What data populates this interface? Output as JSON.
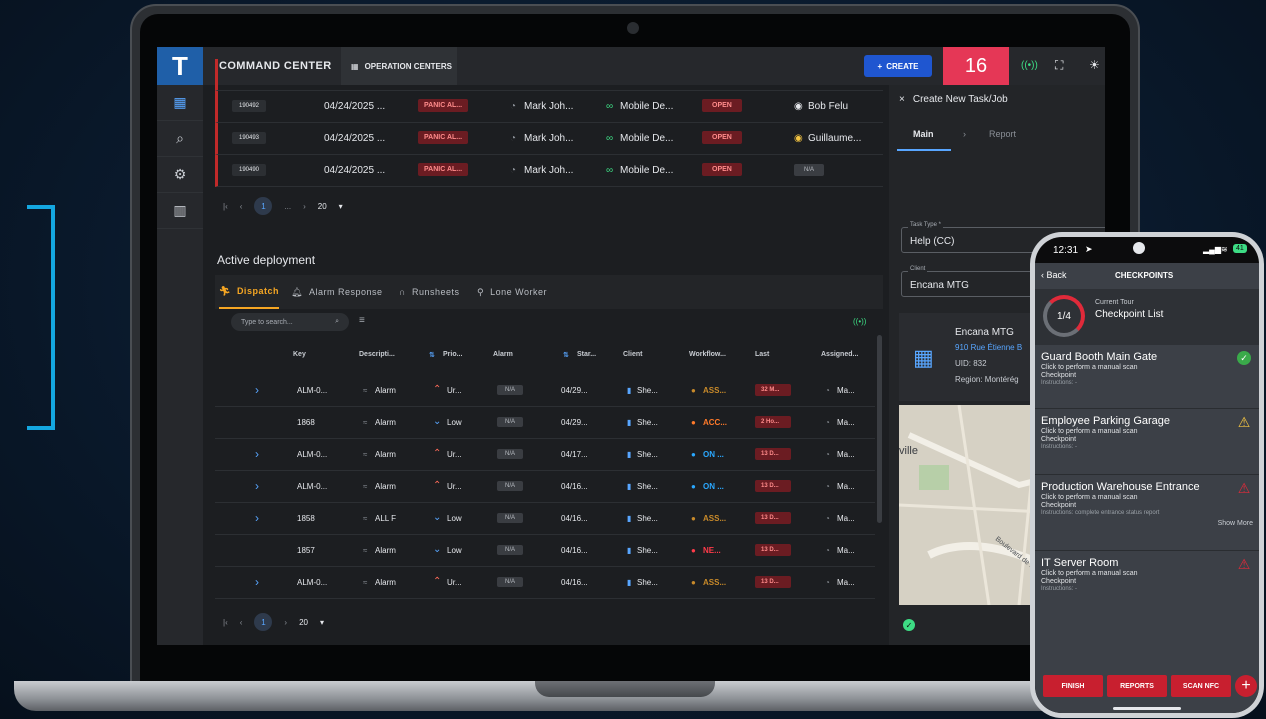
{
  "header": {
    "logo": "T",
    "app_title": "COMMAND CENTER",
    "operation_centers": "OPERATION CENTERS",
    "create": "CREATE",
    "notifications_count": "16"
  },
  "panic_rows": [
    {
      "id": "190492",
      "date": "04/24/2025 ...",
      "alarm": "PANIC AL...",
      "officer": "Mark Joh...",
      "device": "Mobile De...",
      "status": "OPEN",
      "assignee": "Bob Felu"
    },
    {
      "id": "190493",
      "date": "04/24/2025 ...",
      "alarm": "PANIC AL...",
      "officer": "Mark Joh...",
      "device": "Mobile De...",
      "status": "OPEN",
      "assignee": "Guillaume..."
    },
    {
      "id": "190490",
      "date": "04/24/2025 ...",
      "alarm": "PANIC AL...",
      "officer": "Mark Joh...",
      "device": "Mobile De...",
      "status": "OPEN",
      "assignee": "N/A"
    }
  ],
  "pager_top": {
    "page": "1",
    "ellipsis": "...",
    "page_size": "20"
  },
  "active_deployment": {
    "title": "Active deployment",
    "tabs": [
      "Dispatch",
      "Alarm Response",
      "Runsheets",
      "Lone Worker"
    ],
    "search_placeholder": "Type to search...",
    "columns": [
      "Key",
      "Descripti...",
      "Prio...",
      "Alarm",
      "Star...",
      "Client",
      "Workflow...",
      "Last",
      "Assigned..."
    ],
    "rows": [
      {
        "key": "ALM-0...",
        "desc": "Alarm",
        "prio": "Ur...",
        "alarm": "N/A",
        "start": "04/29...",
        "client": "She...",
        "workflow": "ASS...",
        "last": "32 M...",
        "assigned": "Ma..."
      },
      {
        "key": "1868",
        "desc": "Alarm",
        "prio": "Low",
        "alarm": "N/A",
        "start": "04/29...",
        "client": "She...",
        "workflow": "ACC...",
        "last": "2 Ho...",
        "assigned": "Ma..."
      },
      {
        "key": "ALM-0...",
        "desc": "Alarm",
        "prio": "Ur...",
        "alarm": "N/A",
        "start": "04/17...",
        "client": "She...",
        "workflow": "ON ...",
        "last": "13 D...",
        "assigned": "Ma..."
      },
      {
        "key": "ALM-0...",
        "desc": "Alarm",
        "prio": "Ur...",
        "alarm": "N/A",
        "start": "04/16...",
        "client": "She...",
        "workflow": "ON ...",
        "last": "13 D...",
        "assigned": "Ma..."
      },
      {
        "key": "1858",
        "desc": "ALL F",
        "prio": "Low",
        "alarm": "N/A",
        "start": "04/16...",
        "client": "She...",
        "workflow": "ASS...",
        "last": "13 D...",
        "assigned": "Ma..."
      },
      {
        "key": "1857",
        "desc": "Alarm",
        "prio": "Low",
        "alarm": "N/A",
        "start": "04/16...",
        "client": "She...",
        "workflow": "NE...",
        "last": "13 D...",
        "assigned": "Ma..."
      },
      {
        "key": "ALM-0...",
        "desc": "Alarm",
        "prio": "Ur...",
        "alarm": "N/A",
        "start": "04/16...",
        "client": "She...",
        "workflow": "ASS...",
        "last": "13 D...",
        "assigned": "Ma..."
      }
    ],
    "pager": {
      "page": "1",
      "page_size": "20"
    }
  },
  "task_panel": {
    "title": "Create New Task/Job",
    "tab_main": "Main",
    "tab_report": "Report",
    "task_type_label": "Task Type *",
    "task_type_value": "Help (CC)",
    "client_label": "Client",
    "client_value": "Encana MTG",
    "client_name": "Encana MTG",
    "client_address": "910 Rue Étienne B",
    "client_uid": "UID: 832",
    "client_region": "Region: Montérég",
    "map_label_ville": "ville",
    "map_label_boulevard": "Boulevard de Montar"
  },
  "phone": {
    "time": "12:31",
    "battery": "41",
    "back": "Back",
    "title": "CHECKPOINTS",
    "progress": "1/4",
    "tour_label": "Current Tour",
    "tour_name": "Checkpoint List",
    "show_more": "Show More",
    "checkpoints": [
      {
        "title": "Guard Booth Main Gate",
        "sub1": "Click to perform a manual scan",
        "sub2": "Checkpoint",
        "instructions": "Instructions: -"
      },
      {
        "title": "Employee Parking Garage",
        "sub1": "Click to perform a manual scan",
        "sub2": "Checkpoint",
        "instructions": "Instructions: -"
      },
      {
        "title": "Production Warehouse Entrance",
        "sub1": "Click to perform a manual scan",
        "sub2": "Checkpoint",
        "instructions": "Instructions: complete entrance status report"
      },
      {
        "title": "IT Server Room",
        "sub1": "Click to perform a manual scan",
        "sub2": "Checkpoint",
        "instructions": "Instructions: -"
      }
    ],
    "buttons": {
      "finish": "FINISH",
      "reports": "REPORTS",
      "scan_nfc": "SCAN NFC"
    }
  }
}
